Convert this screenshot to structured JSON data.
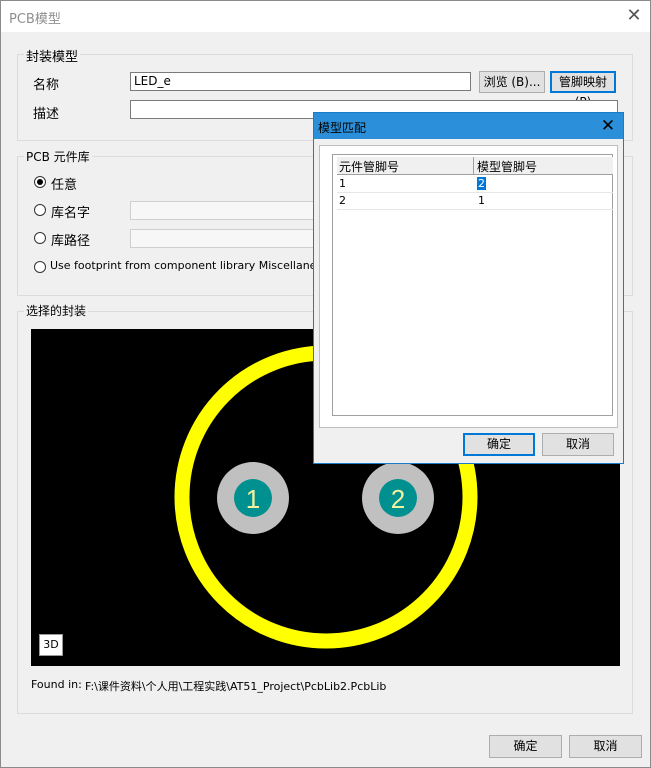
{
  "window": {
    "title": "PCB模型"
  },
  "footprint_group": {
    "label": "封装模型",
    "name_label": "名称",
    "name_value": "LED_e",
    "desc_label": "描述",
    "desc_value": "",
    "browse_label": "浏览 (B)...",
    "pinmap_label": "管脚映射 (P)"
  },
  "library_group": {
    "label": "PCB 元件库",
    "options": [
      {
        "label": "任意",
        "selected": true
      },
      {
        "label": "库名字",
        "selected": false
      },
      {
        "label": "库路径",
        "selected": false
      },
      {
        "label": "Use footprint from component library Miscellaneou",
        "selected": false
      }
    ]
  },
  "selected_group": {
    "label": "选择的封装",
    "pads": [
      "1",
      "2"
    ],
    "btn_3d": "3D",
    "found_in_label": "Found in:",
    "found_in_path": "F:\\课件资料\\个人用\\工程实践\\AT51_Project\\PcbLib2.PcbLib"
  },
  "footer": {
    "ok_label": "确定",
    "cancel_label": "取消"
  },
  "pin_dialog": {
    "title": "模型匹配",
    "columns": [
      "元件管脚号",
      "模型管脚号"
    ],
    "rows": [
      {
        "component_pin": "1",
        "model_pin": "2"
      },
      {
        "component_pin": "2",
        "model_pin": "1"
      }
    ],
    "ok_label": "确定",
    "cancel_label": "取消"
  },
  "colors": {
    "pad_ring": "#c0c0c0",
    "pad_center": "#00908f",
    "pad_text": "#f2f2a0",
    "silkscreen": "#ffff00",
    "preview_bg": "#000000",
    "dialog_title_bg": "#2b90d9"
  }
}
